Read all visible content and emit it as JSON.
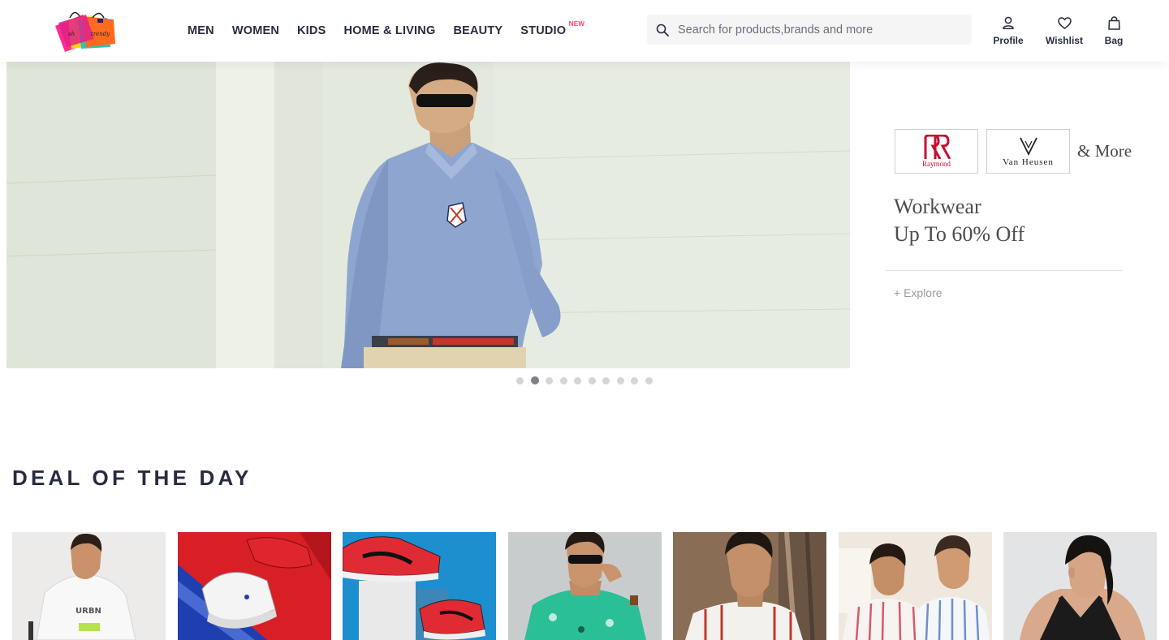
{
  "header": {
    "logo": {
      "icon": "shopping-bags-logo-icon",
      "alt": "Store logo"
    },
    "nav": [
      {
        "label": "MEN"
      },
      {
        "label": "WOMEN"
      },
      {
        "label": "KIDS"
      },
      {
        "label": "HOME & LIVING"
      },
      {
        "label": "BEAUTY"
      },
      {
        "label": "STUDIO",
        "tag": "NEW"
      }
    ],
    "search": {
      "placeholder": "Search for products,brands and more",
      "value": "",
      "icon": "search-icon"
    },
    "actions": [
      {
        "label": "Profile",
        "icon": "user-icon"
      },
      {
        "label": "Wishlist",
        "icon": "heart-icon"
      },
      {
        "label": "Bag",
        "icon": "bag-icon"
      }
    ]
  },
  "hero": {
    "side_promo": {
      "brands": [
        "Raymond",
        "Van Heusen"
      ],
      "more": "& More",
      "title_line1": "Workwear",
      "title_line2": "Up To 60% Off",
      "cta": "+ Explore"
    },
    "carousel": {
      "total": 10,
      "active_index": 1
    }
  },
  "deal_of_the_day": {
    "title": "DEAL OF THE DAY",
    "cards": [
      {
        "name": "boy-white-sweatshirt"
      },
      {
        "name": "white-sneaker-red-background"
      },
      {
        "name": "red-puma-sneakers"
      },
      {
        "name": "man-sunglasses-green-shirt"
      },
      {
        "name": "man-striped-shirt"
      },
      {
        "name": "two-men-striped-shirts"
      },
      {
        "name": "woman-black-sports-top"
      }
    ]
  },
  "colors": {
    "text": "#282c3f",
    "accent": "#ff3f6c",
    "search_bg": "#f5f5f6",
    "dot": "#d4d5d9",
    "dot_active": "#7e818c"
  }
}
